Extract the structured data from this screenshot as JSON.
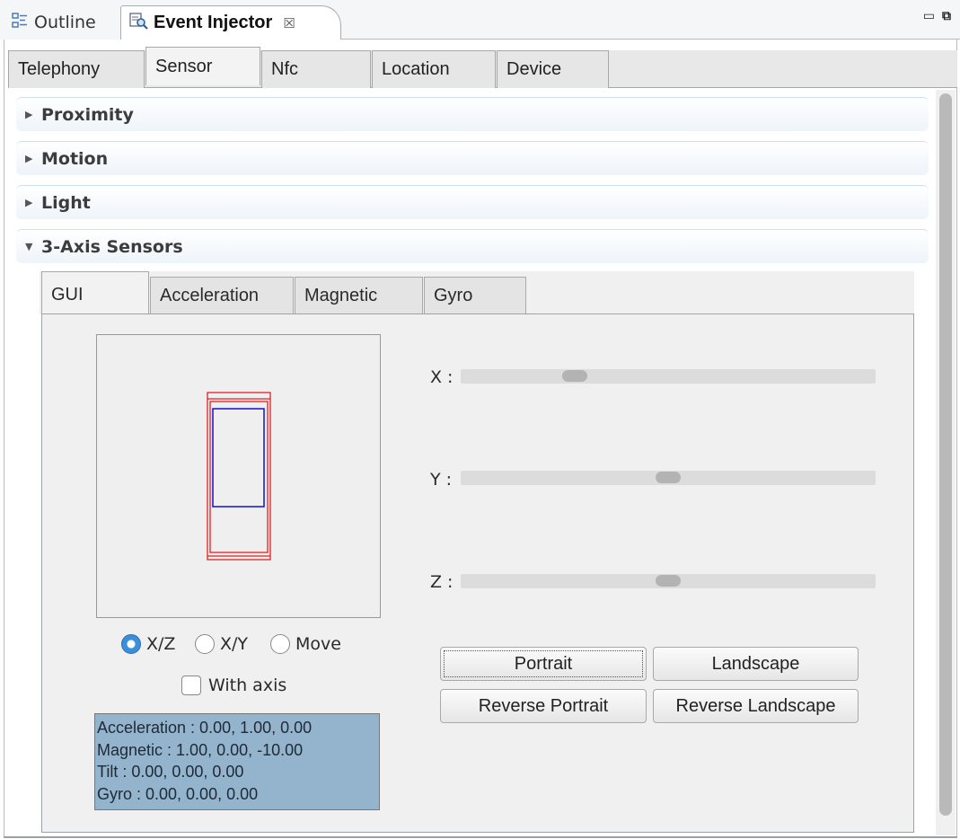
{
  "view_tabs": [
    {
      "label": "Outline",
      "icon": "outline-icon"
    },
    {
      "label": "Event Injector",
      "icon": "event-injector-icon",
      "close": "☒"
    }
  ],
  "sensor_tabs": [
    "Telephony",
    "Sensor",
    "Nfc",
    "Location",
    "Device"
  ],
  "sections": [
    {
      "label": "Proximity",
      "expanded": false
    },
    {
      "label": "Motion",
      "expanded": false
    },
    {
      "label": "Light",
      "expanded": false
    },
    {
      "label": "3-Axis Sensors",
      "expanded": true
    }
  ],
  "inner_tabs": [
    "GUI",
    "Acceleration",
    "Magnetic",
    "Gyro"
  ],
  "view_mode": {
    "options": [
      "X/Z",
      "X/Y",
      "Move"
    ],
    "selected": "X/Z"
  },
  "with_axis": {
    "label": "With axis",
    "checked": false
  },
  "info": {
    "acceleration": "Acceleration : 0.00, 1.00, 0.00",
    "magnetic": "Magnetic : 1.00, 0.00, -10.00",
    "tilt": "Tilt : 0.00, 0.00, 0.00",
    "gyro": "Gyro : 0.00, 0.00, 0.00"
  },
  "sliders": [
    {
      "label": "X :",
      "value_fraction": 0.26
    },
    {
      "label": "Y :",
      "value_fraction": 0.5
    },
    {
      "label": "Z :",
      "value_fraction": 0.5
    }
  ],
  "buttons": {
    "portrait": "Portrait",
    "landscape": "Landscape",
    "reverse_portrait": "Reverse Portrait",
    "reverse_landscape": "Reverse Landscape"
  },
  "colors": {
    "device_outline": "#e02020",
    "device_screen": "#1010d0",
    "info_background": "#94b3cd",
    "radio_selected": "#3b8fd9"
  }
}
